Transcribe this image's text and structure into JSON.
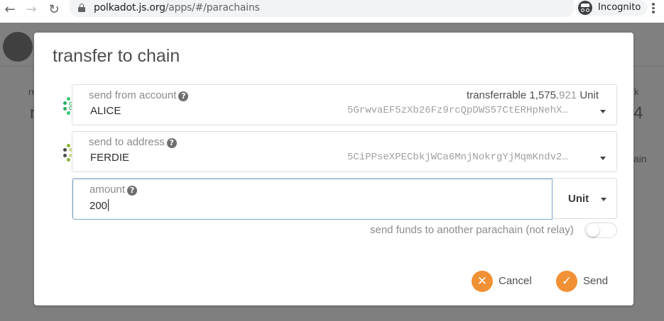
{
  "browser": {
    "url_host": "polkadot.js.org",
    "url_path": "/apps/#/parachains",
    "incognito_label": "Incognito",
    "icons": [
      "back-arrow-icon",
      "forward-arrow-icon",
      "reload-icon",
      "lock-icon",
      "zoom-icon",
      "star-icon",
      "incognito-icon",
      "menu-icon"
    ]
  },
  "background": {
    "fragments": [
      "re",
      "n",
      "k",
      "4",
      "ain"
    ]
  },
  "modal": {
    "title": "transfer to chain",
    "send_from": {
      "label": "send from account",
      "help": "?",
      "account_name": "ALICE",
      "address": "5GrwvaEF5zXb26Fz9rcQpDWS57CtERHpNehX…",
      "transferable_label": "transferrable",
      "transferable_int": "1,575.",
      "transferable_dec": "921",
      "transferable_unit": "Unit"
    },
    "send_to": {
      "label": "send to address",
      "help": "?",
      "account_name": "FERDIE",
      "address": "5CiPPseXPECbkjWCa6MnjNokrgYjMqmKndv2…"
    },
    "amount": {
      "label": "amount",
      "help": "?",
      "value": "200",
      "unit": "Unit"
    },
    "toggle_label": "send funds to another parachain (not relay)",
    "toggle_on": false,
    "cancel_label": "Cancel",
    "send_label": "Send"
  },
  "colors": {
    "accent": "#f19135",
    "focus_border": "#7ea7c9",
    "overlay": "#7f7f7f"
  }
}
